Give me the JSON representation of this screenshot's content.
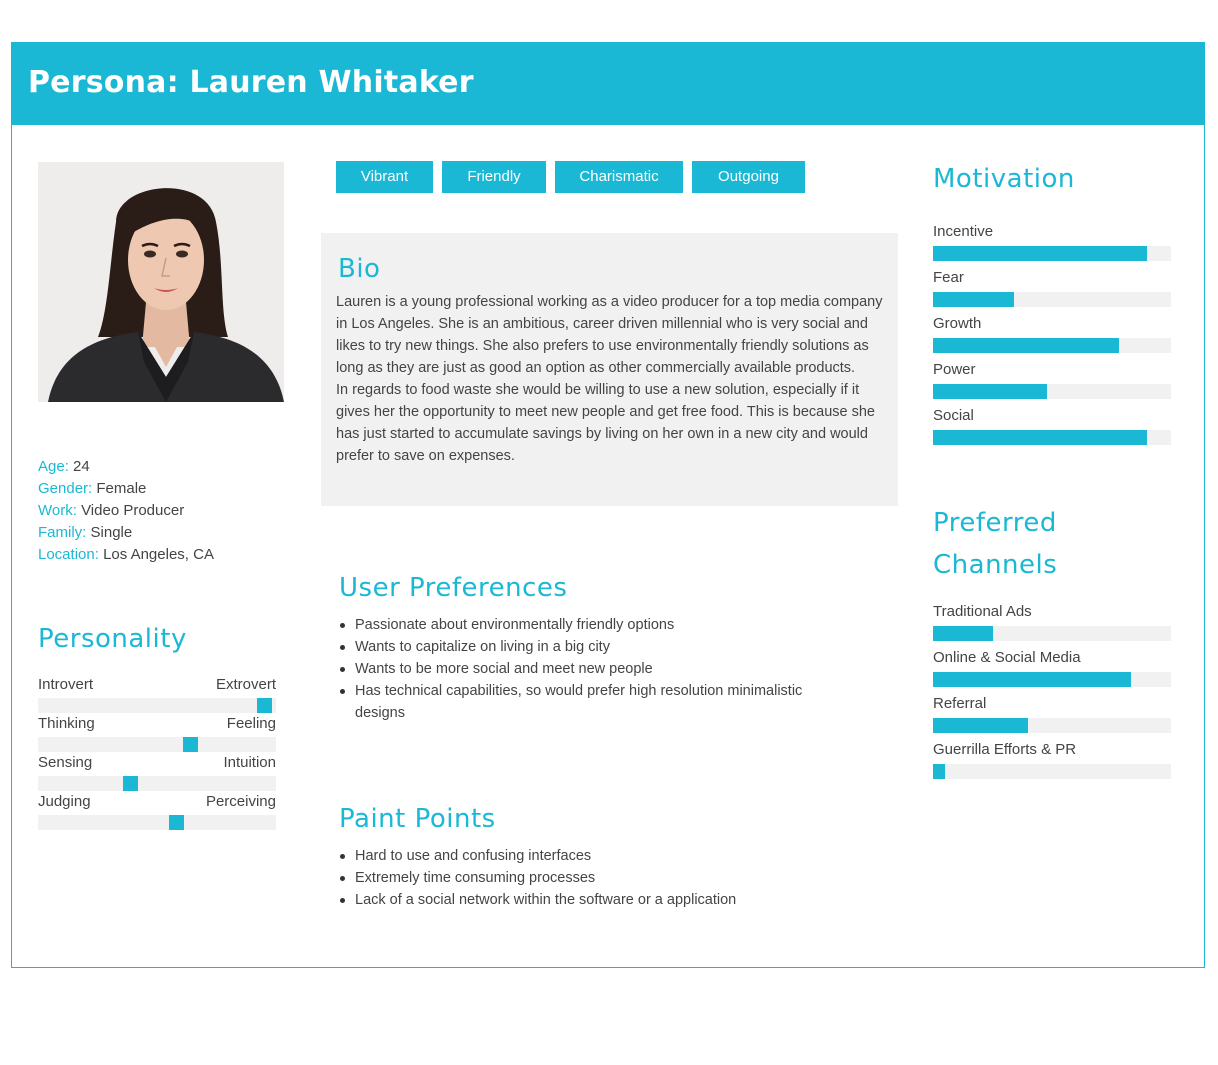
{
  "header": {
    "title": "Persona: Lauren Whitaker"
  },
  "colors": {
    "accent": "#1bb8d5",
    "track": "#f1f1f1"
  },
  "photo": {
    "alt": "portrait"
  },
  "demographics": [
    {
      "key": "Age:",
      "value": "24"
    },
    {
      "key": "Gender:",
      "value": "Female"
    },
    {
      "key": "Work:",
      "value": "Video Producer"
    },
    {
      "key": "Family:",
      "value": "Single"
    },
    {
      "key": "Location:",
      "value": "Los Angeles, CA"
    }
  ],
  "personality": {
    "title": "Personality",
    "scales": [
      {
        "left": "Introvert",
        "right": "Extrovert",
        "value": 0.95
      },
      {
        "left": "Thinking",
        "right": "Feeling",
        "value": 0.64
      },
      {
        "left": "Sensing",
        "right": "Intuition",
        "value": 0.39
      },
      {
        "left": "Judging",
        "right": "Perceiving",
        "value": 0.58
      }
    ]
  },
  "tags": [
    "Vibrant",
    "Friendly",
    "Charismatic",
    "Outgoing"
  ],
  "bio": {
    "title": "Bio",
    "text": "    Lauren is a young professional working as a video producer for a top media company in Los Angeles. She is an ambitious, career driven millennial who is very social and likes to try new things. She also prefers to use environmentally friendly solutions as long as they are just as good an option as other commercially available products.\n    In regards to food waste she would be willing to use a new solution, especially if it gives her the opportunity to meet new people and get free food. This is because she has just started to accumulate savings by living on her own in a new city and would prefer to save on expenses."
  },
  "preferences": {
    "title": "User Preferences",
    "items": [
      "Passionate about environmentally friendly options",
      "Wants to capitalize on living in a big city",
      "Wants to be more social and meet new people",
      "Has technical capabilities, so would prefer high resolution minimalistic designs"
    ]
  },
  "pain_points": {
    "title": "Paint Points",
    "items": [
      "Hard to use and confusing interfaces",
      "Extremely time consuming processes",
      "Lack of a social network within the software or a application"
    ]
  },
  "motivation": {
    "title": "Motivation",
    "items": [
      {
        "label": "Incentive",
        "value": 0.9
      },
      {
        "label": "Fear",
        "value": 0.34
      },
      {
        "label": "Growth",
        "value": 0.78
      },
      {
        "label": "Power",
        "value": 0.48
      },
      {
        "label": "Social",
        "value": 0.9
      }
    ]
  },
  "channels": {
    "title_line1": "Preferred",
    "title_line2": "Channels",
    "items": [
      {
        "label": "Traditional Ads",
        "value": 0.25
      },
      {
        "label": "Online & Social Media",
        "value": 0.83
      },
      {
        "label": "Referral",
        "value": 0.4
      },
      {
        "label": "Guerrilla Efforts & PR",
        "value": 0.05
      }
    ]
  }
}
